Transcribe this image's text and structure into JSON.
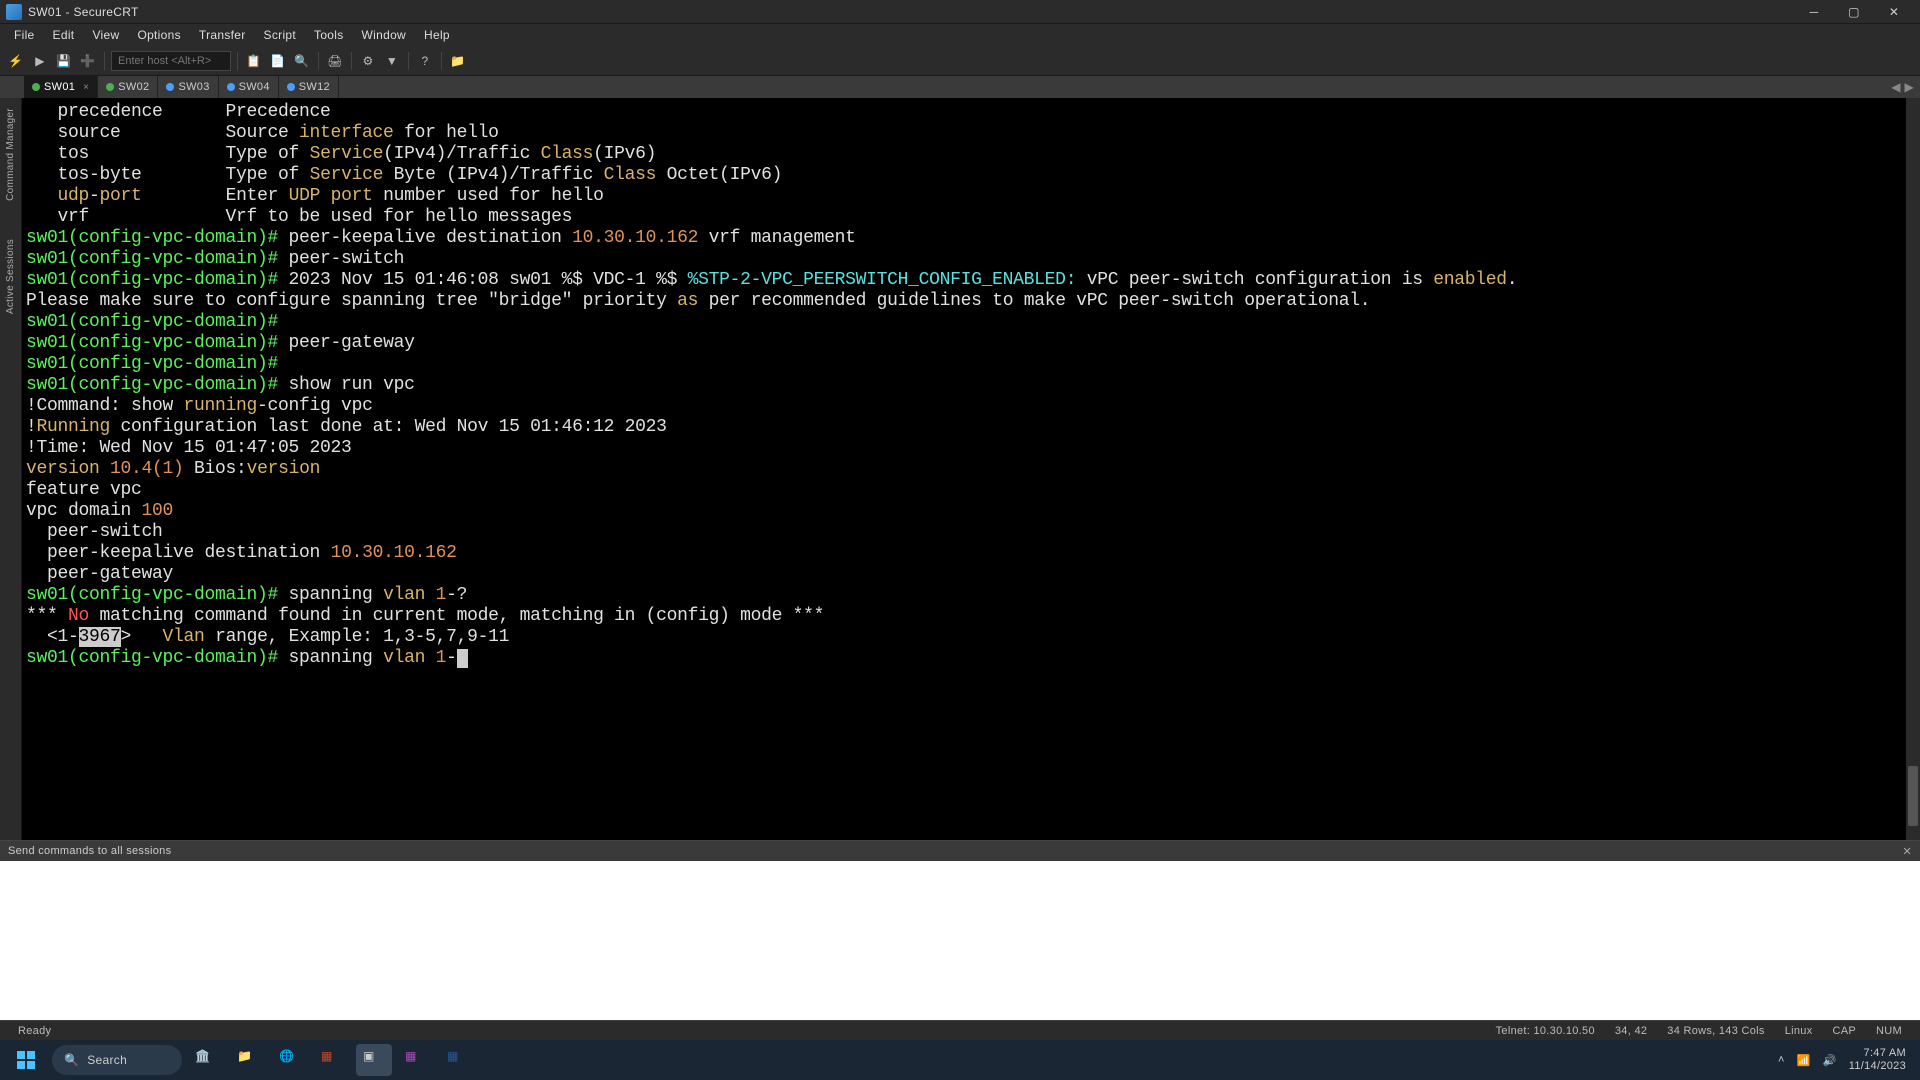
{
  "window": {
    "title": "SW01 - SecureCRT"
  },
  "menu": {
    "items": [
      "File",
      "Edit",
      "View",
      "Options",
      "Transfer",
      "Script",
      "Tools",
      "Window",
      "Help"
    ]
  },
  "toolbar": {
    "host_placeholder": "Enter host <Alt+R>"
  },
  "tabs": [
    {
      "label": "SW01",
      "status": "green",
      "active": true
    },
    {
      "label": "SW02",
      "status": "green",
      "active": false
    },
    {
      "label": "SW03",
      "status": "blue",
      "active": false
    },
    {
      "label": "SW04",
      "status": "blue",
      "active": false
    },
    {
      "label": "SW12",
      "status": "blue",
      "active": false
    }
  ],
  "sidebar": {
    "items": [
      "Command Manager",
      "Active Sessions"
    ]
  },
  "terminal": {
    "lines": [
      {
        "seg": [
          {
            "t": "   precedence      Precedence"
          }
        ]
      },
      {
        "seg": [
          {
            "t": "   source          Source "
          },
          {
            "t": "interface",
            "c": "yellow"
          },
          {
            "t": " for hello"
          }
        ]
      },
      {
        "seg": [
          {
            "t": "   tos             Type of "
          },
          {
            "t": "Service",
            "c": "yellow"
          },
          {
            "t": "(IPv4)/Traffic "
          },
          {
            "t": "Class",
            "c": "yellow"
          },
          {
            "t": "(IPv6)"
          }
        ]
      },
      {
        "seg": [
          {
            "t": "   tos-byte        Type of "
          },
          {
            "t": "Service",
            "c": "yellow"
          },
          {
            "t": " Byte (IPv4)/Traffic "
          },
          {
            "t": "Class",
            "c": "yellow"
          },
          {
            "t": " Octet(IPv6)"
          }
        ]
      },
      {
        "seg": [
          {
            "t": "   "
          },
          {
            "t": "udp",
            "c": "yellow"
          },
          {
            "t": "-"
          },
          {
            "t": "port",
            "c": "yellow"
          },
          {
            "t": "        Enter "
          },
          {
            "t": "UDP",
            "c": "yellow"
          },
          {
            "t": " "
          },
          {
            "t": "port",
            "c": "yellow"
          },
          {
            "t": " number used for hello"
          }
        ]
      },
      {
        "seg": [
          {
            "t": "   vrf             Vrf to be used for hello messages"
          }
        ]
      },
      {
        "seg": [
          {
            "t": ""
          }
        ]
      },
      {
        "seg": [
          {
            "t": "sw01(config-vpc-domain)#",
            "c": "green"
          },
          {
            "t": " peer-keepalive destination "
          },
          {
            "t": "10.30.10.162",
            "c": "orange"
          },
          {
            "t": " vrf management"
          }
        ]
      },
      {
        "seg": [
          {
            "t": "sw01(config-vpc-domain)#",
            "c": "green"
          },
          {
            "t": " peer-switch"
          }
        ]
      },
      {
        "seg": [
          {
            "t": "sw01(config-vpc-domain)#",
            "c": "green"
          },
          {
            "t": " 2023 Nov 15 01:46:08 sw01 %$ VDC-1 %$ "
          },
          {
            "t": "%STP-2-VPC_PEERSWITCH_CONFIG_ENABLED:",
            "c": "cyan"
          },
          {
            "t": " vPC peer-switch configuration is "
          },
          {
            "t": "enabled",
            "c": "yellow"
          },
          {
            "t": "."
          }
        ]
      },
      {
        "seg": [
          {
            "t": "Please make sure to configure spanning tree \"bridge\" priority "
          },
          {
            "t": "as",
            "c": "yellow"
          },
          {
            "t": " per recommended guidelines to make vPC peer-switch operational."
          }
        ]
      },
      {
        "seg": [
          {
            "t": ""
          }
        ]
      },
      {
        "seg": [
          {
            "t": "sw01(config-vpc-domain)#",
            "c": "green"
          }
        ]
      },
      {
        "seg": [
          {
            "t": "sw01(config-vpc-domain)#",
            "c": "green"
          },
          {
            "t": " peer-gateway"
          }
        ]
      },
      {
        "seg": [
          {
            "t": "sw01(config-vpc-domain)#",
            "c": "green"
          }
        ]
      },
      {
        "seg": [
          {
            "t": "sw01(config-vpc-domain)#",
            "c": "green"
          },
          {
            "t": " show run vpc"
          }
        ]
      },
      {
        "seg": [
          {
            "t": ""
          }
        ]
      },
      {
        "seg": [
          {
            "t": "!Command: show "
          },
          {
            "t": "running",
            "c": "yellow"
          },
          {
            "t": "-config vpc"
          }
        ]
      },
      {
        "seg": [
          {
            "t": "!"
          },
          {
            "t": "Running",
            "c": "yellow"
          },
          {
            "t": " configuration last done at: Wed Nov 15 01:46:12 2023"
          }
        ]
      },
      {
        "seg": [
          {
            "t": "!Time: Wed Nov 15 01:47:05 2023"
          }
        ]
      },
      {
        "seg": [
          {
            "t": ""
          }
        ]
      },
      {
        "seg": [
          {
            "t": "version",
            "c": "yellow"
          },
          {
            "t": " "
          },
          {
            "t": "10.4(1)",
            "c": "orange"
          },
          {
            "t": " Bios:"
          },
          {
            "t": "version",
            "c": "yellow"
          }
        ]
      },
      {
        "seg": [
          {
            "t": "feature vpc"
          }
        ]
      },
      {
        "seg": [
          {
            "t": ""
          }
        ]
      },
      {
        "seg": [
          {
            "t": "vpc domain "
          },
          {
            "t": "100",
            "c": "orange"
          }
        ]
      },
      {
        "seg": [
          {
            "t": "  peer-switch"
          }
        ]
      },
      {
        "seg": [
          {
            "t": "  peer-keepalive destination "
          },
          {
            "t": "10.30.10.162",
            "c": "orange"
          }
        ]
      },
      {
        "seg": [
          {
            "t": "  peer-gateway"
          }
        ]
      },
      {
        "seg": [
          {
            "t": ""
          }
        ]
      },
      {
        "seg": [
          {
            "t": "sw01(config-vpc-domain)#",
            "c": "green"
          },
          {
            "t": " spanning "
          },
          {
            "t": "vlan",
            "c": "yellow"
          },
          {
            "t": " "
          },
          {
            "t": "1",
            "c": "orange"
          },
          {
            "t": "-?"
          }
        ]
      },
      {
        "seg": [
          {
            "t": "*** "
          },
          {
            "t": "No",
            "c": "red"
          },
          {
            "t": " matching command found in current mode, matching in (config) mode ***"
          }
        ]
      },
      {
        "seg": [
          {
            "t": "  <1-"
          },
          {
            "t": "3967",
            "hl": true
          },
          {
            "t": ">   "
          },
          {
            "t": "Vlan",
            "c": "yellow"
          },
          {
            "t": " range, Example: 1,3-5,7,9-11"
          }
        ]
      },
      {
        "seg": [
          {
            "t": ""
          }
        ]
      },
      {
        "seg": [
          {
            "t": "sw01(config-vpc-domain)#",
            "c": "green"
          },
          {
            "t": " spanning "
          },
          {
            "t": "vlan",
            "c": "yellow"
          },
          {
            "t": " "
          },
          {
            "t": "1",
            "c": "orange"
          },
          {
            "t": "-"
          }
        ],
        "cursor": true
      }
    ]
  },
  "command_window": {
    "title": "Send commands to all sessions"
  },
  "status": {
    "ready": "Ready",
    "conn": "Telnet: 10.30.10.50",
    "pos": "34, 42",
    "size": "34 Rows, 143 Cols",
    "enc": "Linux",
    "cap": "CAP",
    "num": "NUM"
  },
  "taskbar": {
    "search": "Search",
    "time": "7:47 AM",
    "date": "11/14/2023"
  }
}
